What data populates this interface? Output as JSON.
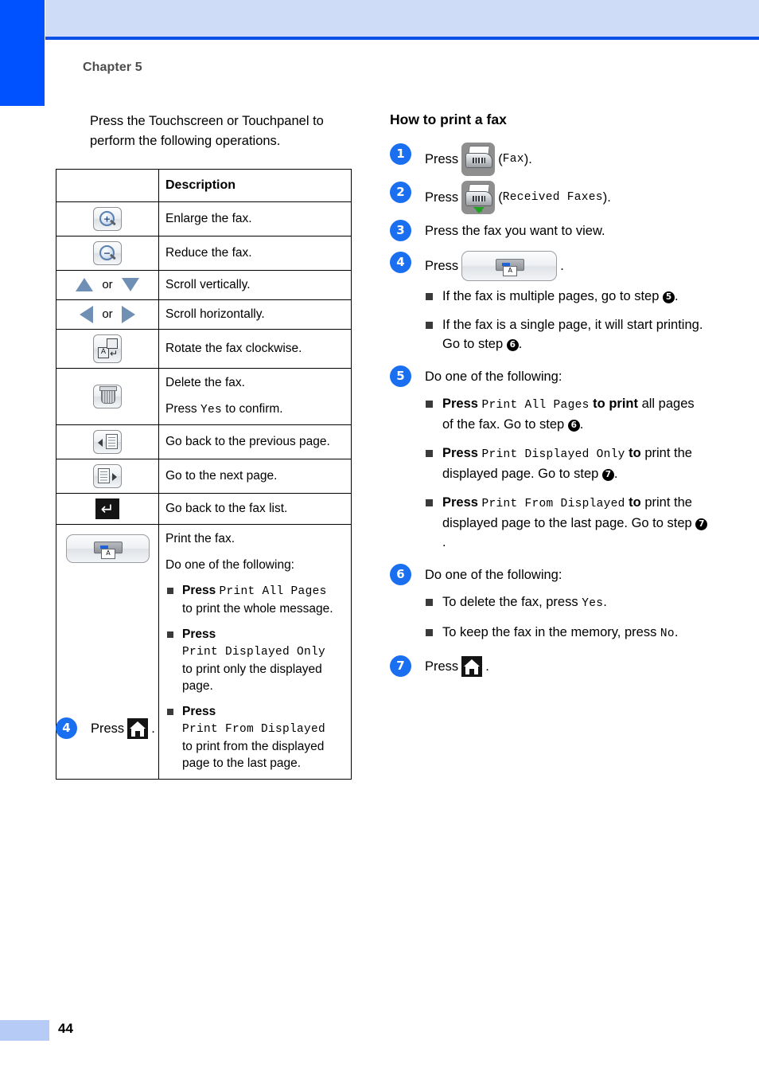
{
  "page": {
    "chapter": "Chapter 5",
    "page_number": "44",
    "accent_blue": "#0051ff",
    "header_band": "#cedcf7",
    "step_circle_blue": "#1a6ff0"
  },
  "left": {
    "intro": "Press the Touchscreen or Touchpanel to perform the following operations.",
    "table": {
      "header_icon_col": "",
      "header_desc_col": "Description",
      "rows": [
        {
          "icon": "zoom-in-icon",
          "desc": "Enlarge the fax."
        },
        {
          "icon": "zoom-out-icon",
          "desc": "Reduce the fax."
        },
        {
          "icon": "up-down-triangles",
          "or_label": "or",
          "desc": "Scroll vertically."
        },
        {
          "icon": "left-right-triangles",
          "or_label": "or",
          "desc": "Scroll horizontally."
        },
        {
          "icon": "rotate-icon",
          "desc": "Rotate the fax clockwise."
        },
        {
          "icon": "trash-icon",
          "desc": "Delete the fax.",
          "desc2_pre": "Press ",
          "desc2_mono": "Yes",
          "desc2_post": " to confirm."
        },
        {
          "icon": "previous-page-icon",
          "desc": "Go back to the previous page."
        },
        {
          "icon": "next-page-icon",
          "desc": "Go to the next page."
        },
        {
          "icon": "return-icon",
          "desc": "Go back to the fax list."
        },
        {
          "icon": "print-button-icon",
          "desc": "Print the fax.",
          "desc2": "Do one of the following:",
          "bullets": [
            {
              "press": "Press ",
              "mono": "Print All Pages",
              "tail": "to print the whole message."
            },
            {
              "press": "Press",
              "mono": "Print Displayed Only",
              "tail": "to print only the displayed page."
            },
            {
              "press": "Press",
              "mono": "Print From Displayed",
              "tail": "to print from the displayed page to the last page."
            }
          ]
        }
      ]
    },
    "step4": {
      "number": "4",
      "press_label": "Press",
      "icon": "home-icon",
      "period": "."
    }
  },
  "right": {
    "title": "How to print a fax",
    "steps": [
      {
        "number": "1",
        "press_label": "Press",
        "icon": "fax-icon",
        "paren_open": "(",
        "mono": "Fax",
        "paren_close": ")."
      },
      {
        "number": "2",
        "press_label": "Press",
        "icon": "received-faxes-icon",
        "paren_open": "(",
        "mono": "Received Faxes",
        "paren_close": ")."
      },
      {
        "number": "3",
        "text": "Press the fax you want to view."
      },
      {
        "number": "4",
        "press_label": "Press",
        "icon": "print-button-icon",
        "period": ".",
        "bullets": [
          {
            "pre": "If the fax is multiple pages, go to step ",
            "cnum": "5",
            "post": "."
          },
          {
            "pre": "If the fax is a single page, it will start printing. Go to step ",
            "cnum": "6",
            "post": "."
          }
        ]
      },
      {
        "number": "5",
        "text": "Do one of the following:",
        "bullets": [
          {
            "pre_bold": "Press ",
            "mono": "Print All Pages",
            "mid_bold": " to print",
            "post": " all pages of the fax. Go to step ",
            "cnum": "6",
            "tail": "."
          },
          {
            "pre_bold": "Press ",
            "mono": "Print Displayed Only",
            "mid_bold": " to",
            "post": " print the displayed page. Go to step ",
            "cnum": "7",
            "tail": "."
          },
          {
            "pre_bold": "Press ",
            "mono": "Print From Displayed",
            "mid_bold": " to",
            "post": " print the displayed page to the last page. Go to step ",
            "cnum": "7",
            "tail": "."
          }
        ]
      },
      {
        "number": "6",
        "text": "Do one of the following:",
        "bullets": [
          {
            "pre": "To delete the fax, press ",
            "mono": "Yes",
            "post": "."
          },
          {
            "pre": "To keep the fax in the memory, press ",
            "mono": "No",
            "post": "."
          }
        ]
      },
      {
        "number": "7",
        "press_label": "Press",
        "icon": "home-icon",
        "period": "."
      }
    ]
  }
}
